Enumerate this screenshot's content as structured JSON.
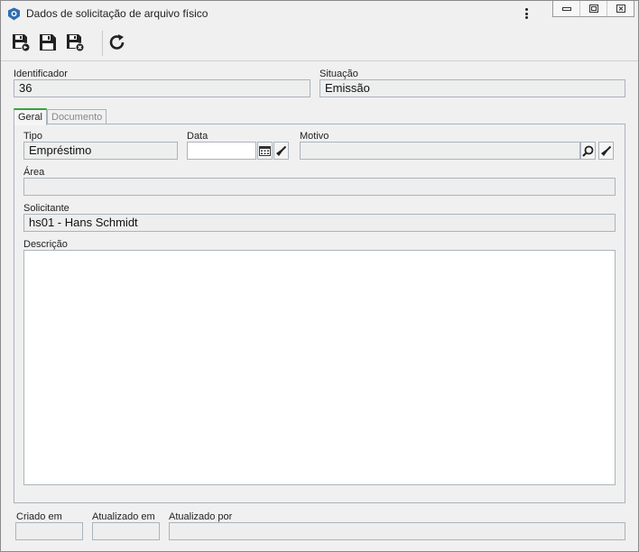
{
  "window": {
    "title": "Dados de solicitação de arquivo físico"
  },
  "toolbar": {
    "buttons": [
      "save-and-new-icon",
      "save-icon",
      "save-and-close-icon",
      "refresh-icon"
    ]
  },
  "header": {
    "identificador_label": "Identificador",
    "identificador_value": "36",
    "situacao_label": "Situação",
    "situacao_value": "Emissão"
  },
  "tabs": [
    {
      "label": "Geral",
      "active": true
    },
    {
      "label": "Documento",
      "active": false
    }
  ],
  "geral": {
    "tipo_label": "Tipo",
    "tipo_value": "Empréstimo",
    "data_label": "Data",
    "data_value": "",
    "motivo_label": "Motivo",
    "motivo_value": "",
    "area_label": "Área",
    "area_value": "",
    "solicitante_label": "Solicitante",
    "solicitante_value": "hs01 - Hans Schmidt",
    "descricao_label": "Descrição",
    "descricao_value": ""
  },
  "footer": {
    "criado_em_label": "Criado em",
    "criado_em_value": "",
    "atualizado_em_label": "Atualizado em",
    "atualizado_em_value": "",
    "atualizado_por_label": "Atualizado por",
    "atualizado_por_value": ""
  },
  "colors": {
    "active_tab_accent": "#3aa23a",
    "field_border": "#a9b4bd",
    "readonly_bg": "#eeeeee"
  }
}
